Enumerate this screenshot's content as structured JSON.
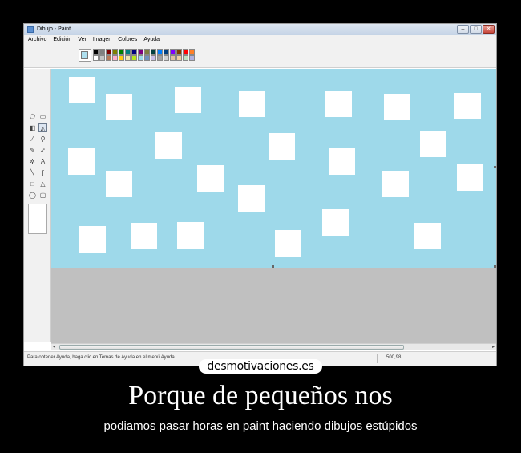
{
  "window": {
    "title": "Dibujo - Paint",
    "buttons": {
      "minimize": "–",
      "maximize": "□",
      "close": "✕"
    }
  },
  "menu": [
    "Archivo",
    "Edición",
    "Ver",
    "Imagen",
    "Colores",
    "Ayuda"
  ],
  "palette": {
    "foreground": "#aee0ef",
    "background": "#ffffff",
    "row1": [
      "#000000",
      "#7f7f7f",
      "#7f0000",
      "#7f7f00",
      "#007f00",
      "#007f7f",
      "#00007f",
      "#7f007f",
      "#7f7f3f",
      "#003f3f",
      "#007fff",
      "#003f7f",
      "#7f00ff",
      "#7f3f00",
      "#ff0000",
      "#ff7f27"
    ],
    "row2": [
      "#ffffff",
      "#c3c3c3",
      "#b97a57",
      "#ffaec9",
      "#ffc90e",
      "#efe4b0",
      "#b5e61d",
      "#99d9ea",
      "#7092be",
      "#c8bfe7",
      "#a0a0a0",
      "#d0d0d0",
      "#e0c0a0",
      "#f0d0a0",
      "#c0e0c0",
      "#b0b0e0"
    ]
  },
  "tools": [
    "free-select-icon",
    "rect-select-icon",
    "eraser-icon",
    "fill-icon",
    "color-picker-icon",
    "magnifier-icon",
    "pencil-icon",
    "brush-icon",
    "airbrush-icon",
    "text-icon",
    "line-icon",
    "curve-icon",
    "rectangle-icon",
    "polygon-icon",
    "ellipse-icon",
    "rounded-rect-icon"
  ],
  "canvas": {
    "color": "#9ed9ea",
    "square_color": "#ffffff",
    "workspace_color": "#c0c0c0"
  },
  "status": {
    "help_text": "Para obtener Ayuda, haga clic en Temas de Ayuda en el menú Ayuda.",
    "coords": "500,98"
  },
  "poster": {
    "site": "desmotivaciones.es",
    "headline": "Porque de pequeños nos",
    "subline": "podiamos pasar horas en paint haciendo dibujos estúpidos"
  }
}
